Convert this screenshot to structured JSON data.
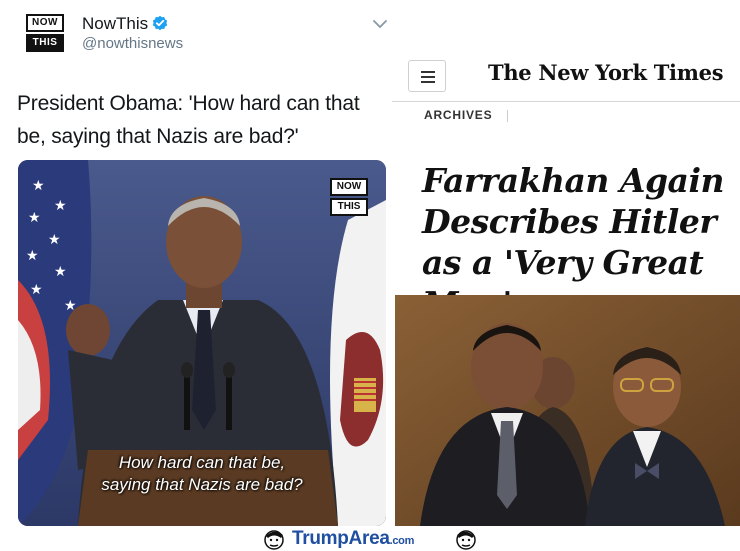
{
  "tweet": {
    "logo": {
      "top": "NOW",
      "bottom": "THIS"
    },
    "name": "NowThis",
    "handle": "@nowthisnews",
    "text": "President Obama: 'How hard can that be, saying that Nazis are bad?'",
    "video": {
      "logo": {
        "top": "NOW",
        "bottom": "THIS"
      },
      "subtitle_line1": "How hard can that be,",
      "subtitle_line2": "saying that Nazis are bad?"
    }
  },
  "nyt": {
    "masthead": "The New York Times",
    "section": "ARCHIVES",
    "headline": "Farrakhan Again Describes Hitler as a 'Very Great Man'"
  },
  "footer": {
    "brand": "TrumpArea",
    "tld": ".com"
  },
  "colors": {
    "verified": "#1da1f2",
    "handle": "#657786",
    "brand": "#1f4fa0"
  },
  "icons": {
    "verified": "verified-badge-icon",
    "caret": "chevron-down-icon",
    "menu": "hamburger-menu-icon"
  }
}
